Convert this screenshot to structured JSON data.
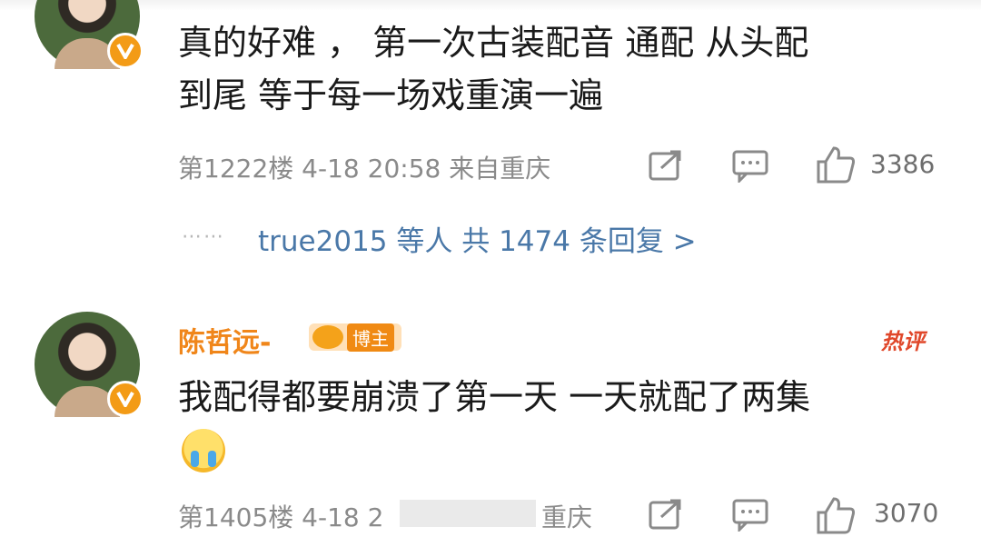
{
  "comments": [
    {
      "content_lines": [
        "真的好难 ， 第一次古装配音 通配 从头配",
        "到尾 等于每一场戏重演一遍"
      ],
      "floor": "第1222楼",
      "date": "4-18",
      "time": "20:58",
      "location": "来自重庆",
      "likes": "3386"
    },
    {
      "author": "陈哲远-",
      "badge": "博主",
      "hot_tag": "热评",
      "content": "我配得都要崩溃了第一天 一天就配了两集",
      "floor": "第1405楼",
      "date": "4-18",
      "time_partial": "2",
      "location_partial": "重庆",
      "likes": "3070"
    }
  ],
  "replies": {
    "dots": "⋯⋯",
    "text": "true2015 等人  共 1474 条回复 >"
  },
  "icons": {
    "share": "share-icon",
    "comment": "comment-icon",
    "like": "thumbs-up-icon",
    "verified": "verified-v-icon",
    "emoji": "crying-emoji-icon"
  },
  "colors": {
    "author": "#f0861a",
    "link": "#4a78a8",
    "meta": "#8a8a8a",
    "hot": "#e0472a"
  }
}
